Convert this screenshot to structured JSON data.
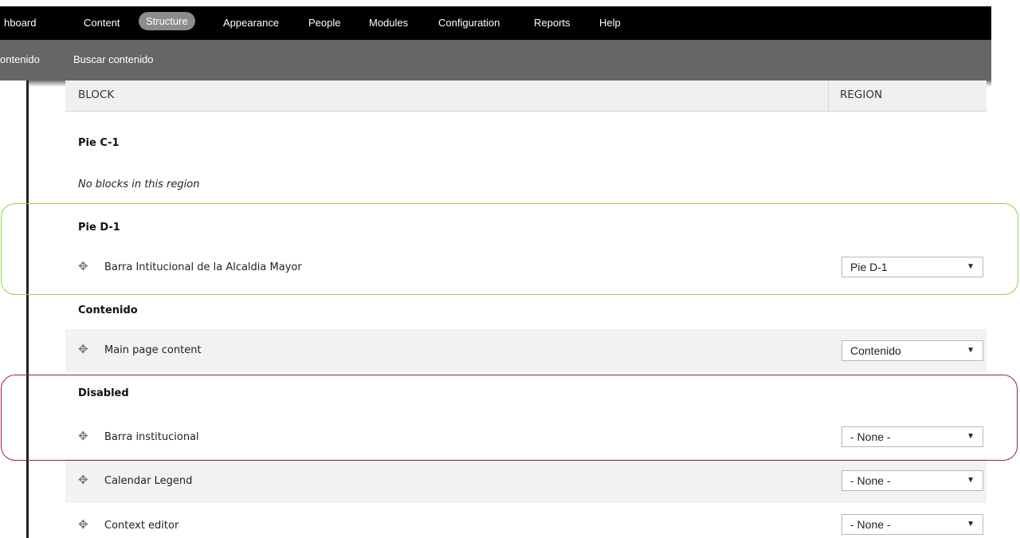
{
  "toolbar": {
    "items": [
      {
        "label": "hboard"
      },
      {
        "label": "Content"
      },
      {
        "label": "Structure",
        "active": true
      },
      {
        "label": "Appearance"
      },
      {
        "label": "People"
      },
      {
        "label": "Modules"
      },
      {
        "label": "Configuration"
      },
      {
        "label": "Reports"
      },
      {
        "label": "Help"
      }
    ]
  },
  "shortcuts": {
    "items": [
      {
        "label": "ontenido"
      },
      {
        "label": "Buscar contenido"
      }
    ]
  },
  "table": {
    "headers": {
      "block": "BLOCK",
      "region": "REGION"
    },
    "regions": [
      {
        "title": "Pie C-1",
        "empty_message": "No blocks in this region"
      },
      {
        "title": "Pie D-1",
        "blocks": [
          {
            "name": "Barra Intitucional de la Alcaldia Mayor",
            "region": "Pie D-1"
          }
        ]
      },
      {
        "title": "Contenido",
        "blocks": [
          {
            "name": "Main page content",
            "region": "Contenido"
          }
        ]
      },
      {
        "title": "Disabled",
        "blocks": [
          {
            "name": "Barra institucional",
            "region": "- None -"
          },
          {
            "name": "Calendar Legend",
            "region": "- None -"
          },
          {
            "name": "Context editor",
            "region": "- None -"
          }
        ]
      }
    ]
  },
  "icons": {
    "drag": "move-handle-icon",
    "dropdown": "caret-down-icon"
  },
  "colors": {
    "toolbar_bg": "#000000",
    "shortcut_bg": "#666666",
    "active_tab_bg": "#8c8c8c",
    "highlight_green": "#8fd14f",
    "highlight_purple": "#a0195f"
  },
  "glyphs": {
    "drag": "✥",
    "caret": "▼"
  }
}
